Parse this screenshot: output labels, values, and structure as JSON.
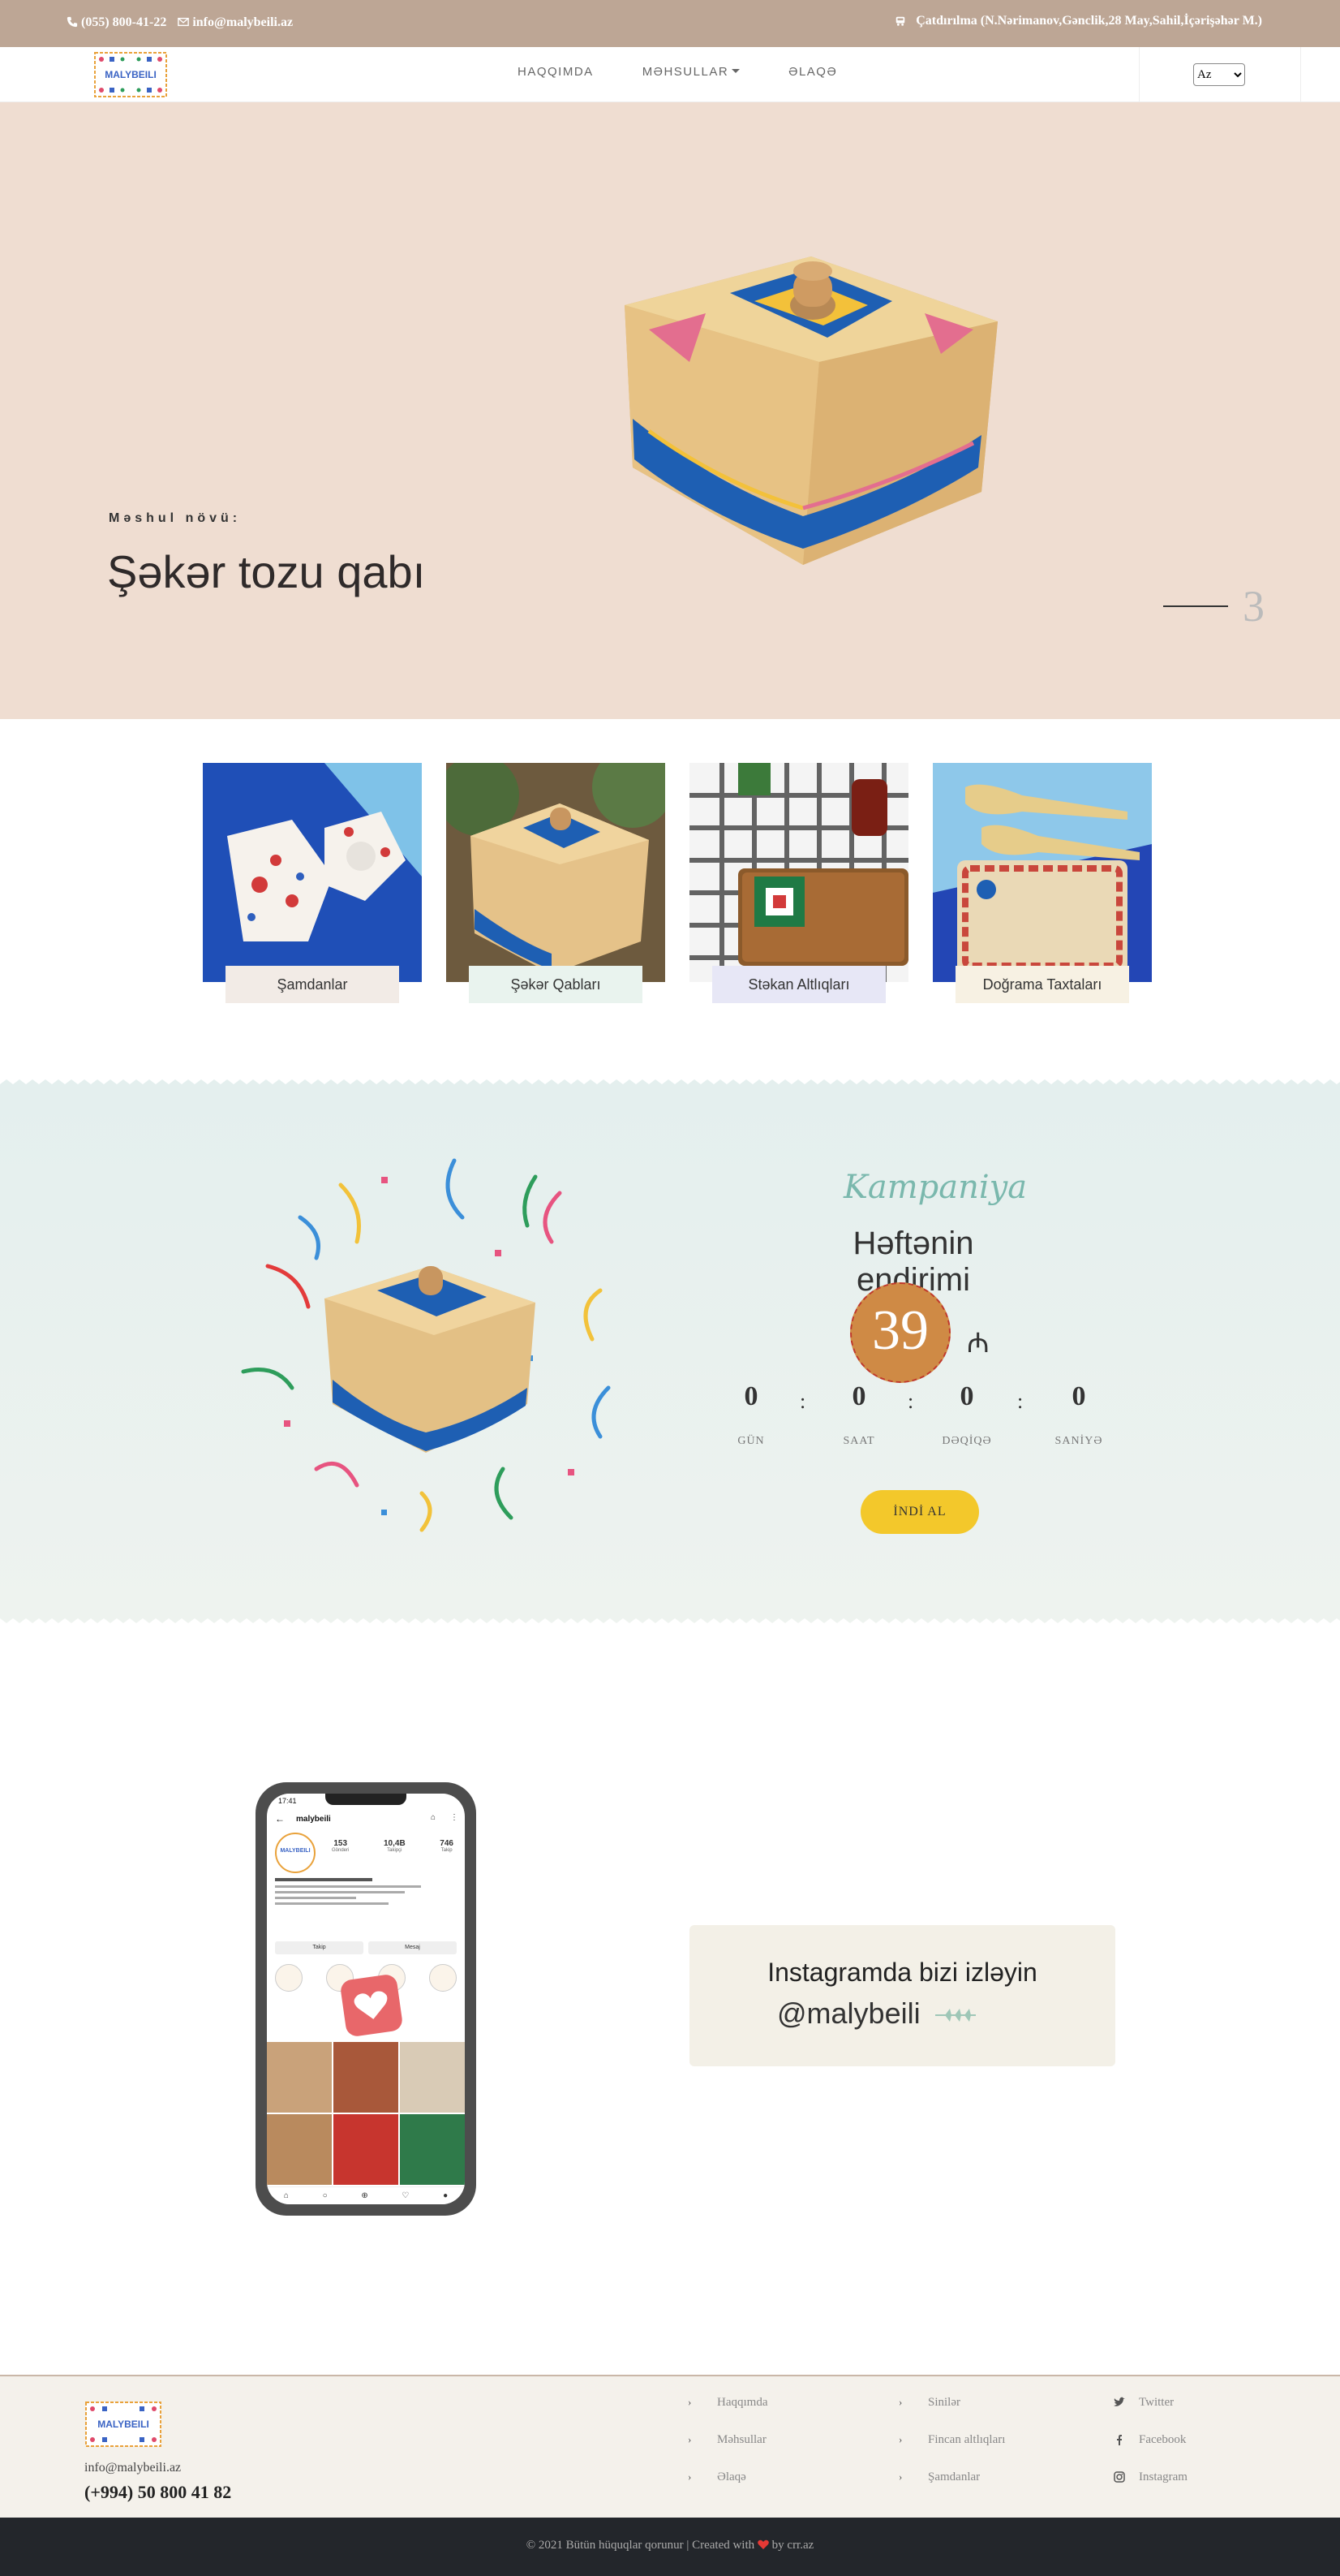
{
  "topbar": {
    "phone": "(055) 800-41-22",
    "email": "info@malybeili.az",
    "delivery": "Çatdırılma (N.Nərimanov,Gənclik,28 May,Sahil,İçərişəhər M.)"
  },
  "logo": {
    "text": "MALYBEILI"
  },
  "nav": {
    "about": "HAQQIMDA",
    "products": "MƏHSULLAR",
    "contact": "ƏLAQƏ",
    "lang_selected": "Az"
  },
  "hero": {
    "kind_label": "Məshul növü:",
    "product_name": "Şəkər tozu qabı",
    "slide_current": "3",
    "slide_total": "3"
  },
  "categories": [
    {
      "label": "Şamdanlar",
      "color": "#f2ebe6"
    },
    {
      "label": "Şəkər Qabları",
      "color": "#e9f3ee"
    },
    {
      "label": "Stəkan Altlıqları",
      "color": "#e7e7f6"
    },
    {
      "label": "Doğrama Taxtaları",
      "color": "#f7f1e3"
    }
  ],
  "campaign": {
    "title": "Kampaniya",
    "subtitle": "Həftənin endirimi",
    "price": "39",
    "currency": "₼",
    "countdown": [
      {
        "value": "0",
        "label": "GÜN"
      },
      {
        "value": "0",
        "label": "SAAT"
      },
      {
        "value": "0",
        "label": "DƏQİQƏ"
      },
      {
        "value": "0",
        "label": "SANİYƏ"
      }
    ],
    "cta": "İNDİ AL"
  },
  "instagram": {
    "heading": "Instagramda bizi izləyin",
    "handle": "@malybeili",
    "phone_screen": {
      "time": "17:41",
      "account": "malybeili",
      "posts": "153",
      "posts_label": "Gönderi",
      "followers": "10,4B",
      "followers_label": "Takipçi",
      "following": "746",
      "following_label": "Takip",
      "follow_button": "Takip",
      "message_button": "Mesaj"
    }
  },
  "footer": {
    "email": "info@malybeili.az",
    "phone": "(+994) 50 800 41 82",
    "col1": [
      "Haqqımda",
      "Məhsullar",
      "Əlaqə"
    ],
    "col2": [
      "Sinilər",
      "Fincan altlıqları",
      "Şamdanlar"
    ],
    "col3": [
      "Twitter",
      "Facebook",
      "Instagram"
    ],
    "copyright_before": "© 2021 Bütün hüquqlar qorunur | Created with",
    "copyright_after": "by crr.az",
    "heart_color": "#e53935"
  },
  "colors": {
    "topbar": "#bda695",
    "hero_bg": "#efddd1",
    "cta": "#f3c82b",
    "price_badge": "#cf8a45",
    "footer_bottom": "#23262b"
  }
}
